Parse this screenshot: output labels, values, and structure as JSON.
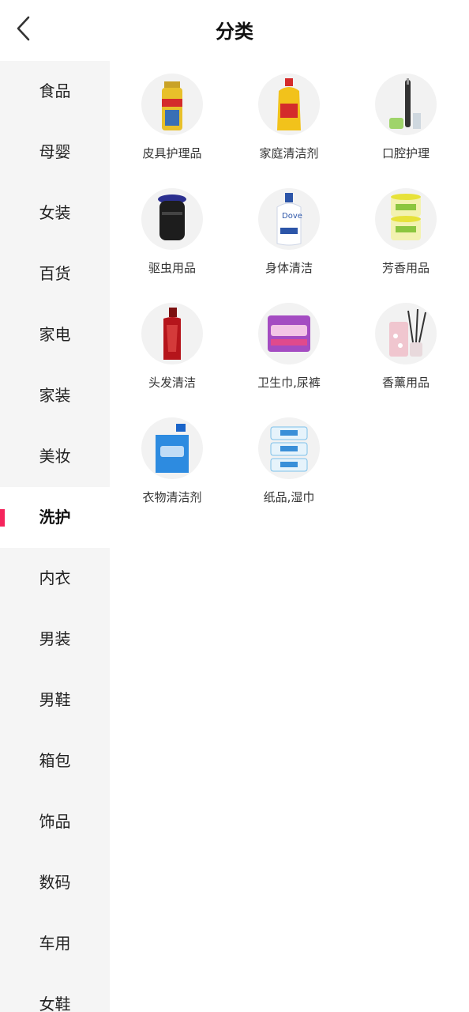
{
  "header": {
    "title": "分类",
    "back_icon": "chevron-left-icon"
  },
  "colors": {
    "accent": "#f5245c",
    "sidebar_bg": "#f5f5f5"
  },
  "sidebar": {
    "items": [
      {
        "label": "食品",
        "active": false
      },
      {
        "label": "母婴",
        "active": false
      },
      {
        "label": "女装",
        "active": false
      },
      {
        "label": "百货",
        "active": false
      },
      {
        "label": "家电",
        "active": false
      },
      {
        "label": "家装",
        "active": false
      },
      {
        "label": "美妆",
        "active": false
      },
      {
        "label": "洗护",
        "active": true
      },
      {
        "label": "内衣",
        "active": false
      },
      {
        "label": "男装",
        "active": false
      },
      {
        "label": "男鞋",
        "active": false
      },
      {
        "label": "箱包",
        "active": false
      },
      {
        "label": "饰品",
        "active": false
      },
      {
        "label": "数码",
        "active": false
      },
      {
        "label": "车用",
        "active": false
      },
      {
        "label": "女鞋",
        "active": false
      }
    ]
  },
  "categories": [
    {
      "label": "皮具护理品",
      "icon": "leather-spray-icon"
    },
    {
      "label": "家庭清洁剂",
      "icon": "cleaner-bottle-icon"
    },
    {
      "label": "口腔护理",
      "icon": "toothbrush-icon"
    },
    {
      "label": "驱虫用品",
      "icon": "mosquito-lamp-icon"
    },
    {
      "label": "身体清洁",
      "icon": "body-wash-icon"
    },
    {
      "label": "芳香用品",
      "icon": "air-freshener-icon"
    },
    {
      "label": "头发清洁",
      "icon": "shampoo-icon"
    },
    {
      "label": "卫生巾,尿裤",
      "icon": "sanitary-pad-icon"
    },
    {
      "label": "香薰用品",
      "icon": "reed-diffuser-icon"
    },
    {
      "label": "衣物清洁剂",
      "icon": "laundry-detergent-icon"
    },
    {
      "label": "纸品,湿巾",
      "icon": "wet-wipes-icon"
    }
  ]
}
